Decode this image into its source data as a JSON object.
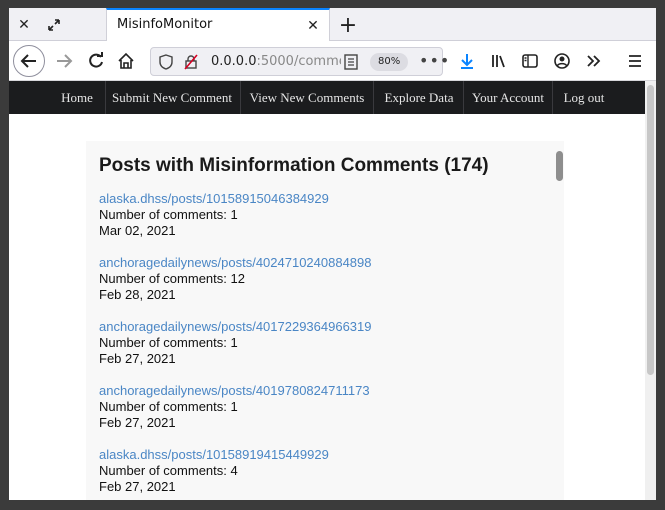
{
  "browser": {
    "tab_title": "MisinfoMonitor",
    "url_host": "0.0.0.0",
    "url_rest": ":5000/commen",
    "zoom": "80%"
  },
  "sitenav": {
    "items": [
      "Home",
      "Submit New Comment",
      "View New Comments",
      "Explore Data",
      "Your Account",
      "Log out"
    ]
  },
  "content": {
    "title": "Posts with Misinformation Comments (174)",
    "posts": [
      {
        "link": "alaska.dhss/posts/10158915046384929",
        "comments": "Number of comments: 1",
        "date": "Mar 02, 2021"
      },
      {
        "link": "anchoragedailynews/posts/4024710240884898",
        "comments": "Number of comments: 12",
        "date": "Feb 28, 2021"
      },
      {
        "link": "anchoragedailynews/posts/4017229364966319",
        "comments": "Number of comments: 1",
        "date": "Feb 27, 2021"
      },
      {
        "link": "anchoragedailynews/posts/4019780824711173",
        "comments": "Number of comments: 1",
        "date": "Feb 27, 2021"
      },
      {
        "link": "alaska.dhss/posts/10158919415449929",
        "comments": "Number of comments: 4",
        "date": "Feb 27, 2021"
      }
    ]
  },
  "colors": {
    "accent": "#0a84ff",
    "link": "#4a86c5",
    "nav_bg": "#1b1c1e"
  }
}
